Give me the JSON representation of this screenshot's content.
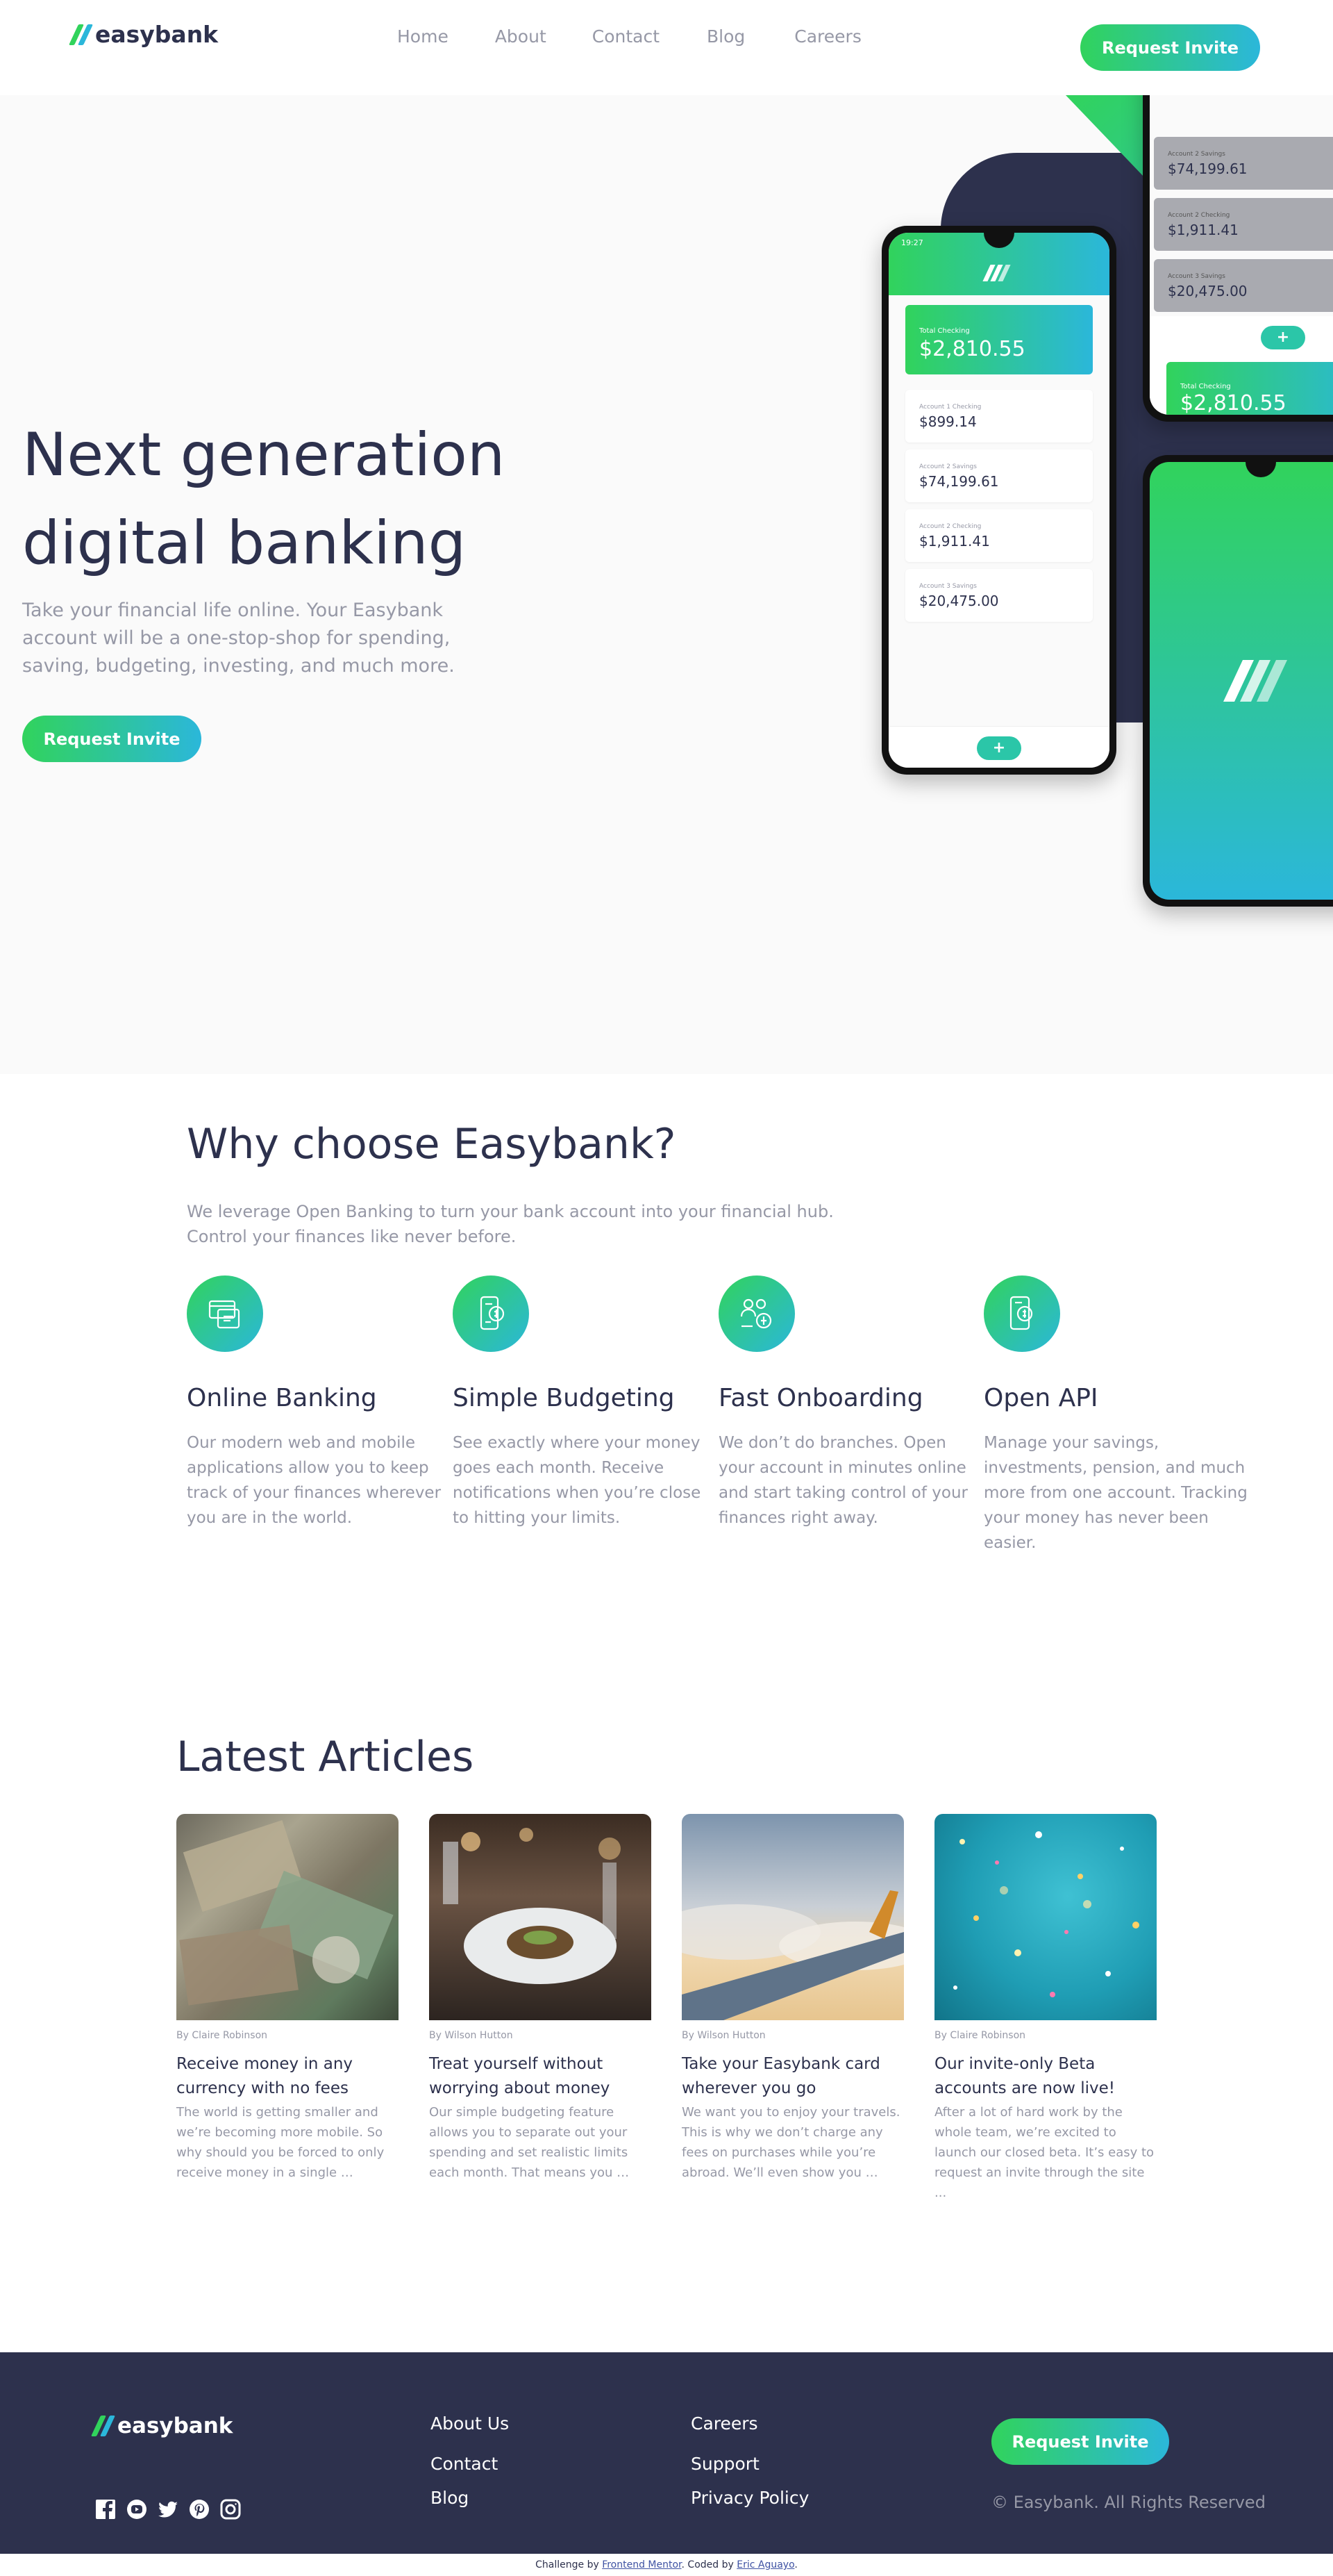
{
  "brand": {
    "name": "easybank"
  },
  "colors": {
    "dark_blue": "#2d314d",
    "lime_green": "#31d35c",
    "bright_cyan": "#2bb7da",
    "grayish_blue": "#9698a6",
    "light_gray": "#fafafa"
  },
  "nav": {
    "items": [
      "Home",
      "About",
      "Contact",
      "Blog",
      "Careers"
    ],
    "cta": "Request Invite"
  },
  "hero": {
    "title_line1": "Next generation",
    "title_line2": "digital banking",
    "text": "Take your financial life online. Your Easybank account will be a one-stop-shop for spending, saving, budgeting, investing, and much more.",
    "cta": "Request Invite",
    "mockups": {
      "status_time": "19:27",
      "total_label": "Total Checking",
      "total_amount": "$2,810.55",
      "accounts": [
        {
          "label": "Account 1 Checking",
          "amount": "$899.14"
        },
        {
          "label": "Account 2 Savings",
          "amount": "$74,199.61"
        },
        {
          "label": "Account 2 Checking",
          "amount": "$1,911.41"
        },
        {
          "label": "Account 3 Savings",
          "amount": "$20,475.00"
        }
      ]
    }
  },
  "features": {
    "title": "Why choose Easybank?",
    "lead": "We leverage Open Banking to turn your bank account into your financial hub. Control your finances like never before.",
    "items": [
      {
        "icon": "online-banking-icon",
        "title": "Online Banking",
        "text": "Our modern web and mobile applications allow you to keep track of your finances wherever you are in the world."
      },
      {
        "icon": "budgeting-icon",
        "title": "Simple Budgeting",
        "text": "See exactly where your money goes each month. Receive notifications when you’re close to hitting your limits."
      },
      {
        "icon": "onboarding-icon",
        "title": "Fast Onboarding",
        "text": "We don’t do branches. Open your account in minutes online and start taking control of your finances right away."
      },
      {
        "icon": "api-icon",
        "title": "Open API",
        "text": "Manage your savings, investments, pension, and much more from one account. Tracking your money has never been easier."
      }
    ]
  },
  "articles": {
    "title": "Latest Articles",
    "items": [
      {
        "author": "By Claire Robinson",
        "title": "Receive money in any currency with no fees",
        "excerpt": "The world is getting smaller and we’re becoming more mobile. So why should you be forced to only receive money in a single …",
        "image": "currency-photo"
      },
      {
        "author": "By Wilson Hutton",
        "title": "Treat yourself without worrying about money",
        "excerpt": "Our simple budgeting feature allows you to separate out your spending and set realistic limits each month. That means you …",
        "image": "restaurant-photo"
      },
      {
        "author": "By Wilson Hutton",
        "title": "Take your Easybank card wherever you go",
        "excerpt": "We want you to enjoy your travels. This is why we don’t charge any fees on purchases while you’re abroad. We’ll even show you …",
        "image": "plane-photo"
      },
      {
        "author": "By Claire Robinson",
        "title": "Our invite-only Beta accounts are now live!",
        "excerpt": "After a lot of hard work by the whole team, we’re excited to launch our closed beta. It’s easy to request an invite through the site ...",
        "image": "confetti-photo"
      }
    ]
  },
  "footer": {
    "links_col1": [
      "About Us",
      "Contact",
      "Blog"
    ],
    "links_col2": [
      "Careers",
      "Support",
      "Privacy Policy"
    ],
    "cta": "Request Invite",
    "copyright": "© Easybank. All Rights Reserved",
    "socials": [
      "facebook-icon",
      "youtube-icon",
      "twitter-icon",
      "pinterest-icon",
      "instagram-icon"
    ]
  },
  "attribution": {
    "prefix": "Challenge by",
    "challenge_link": "Frontend Mentor",
    "middle": ". Coded by",
    "author_link": "Eric Aguayo",
    "suffix": "."
  }
}
